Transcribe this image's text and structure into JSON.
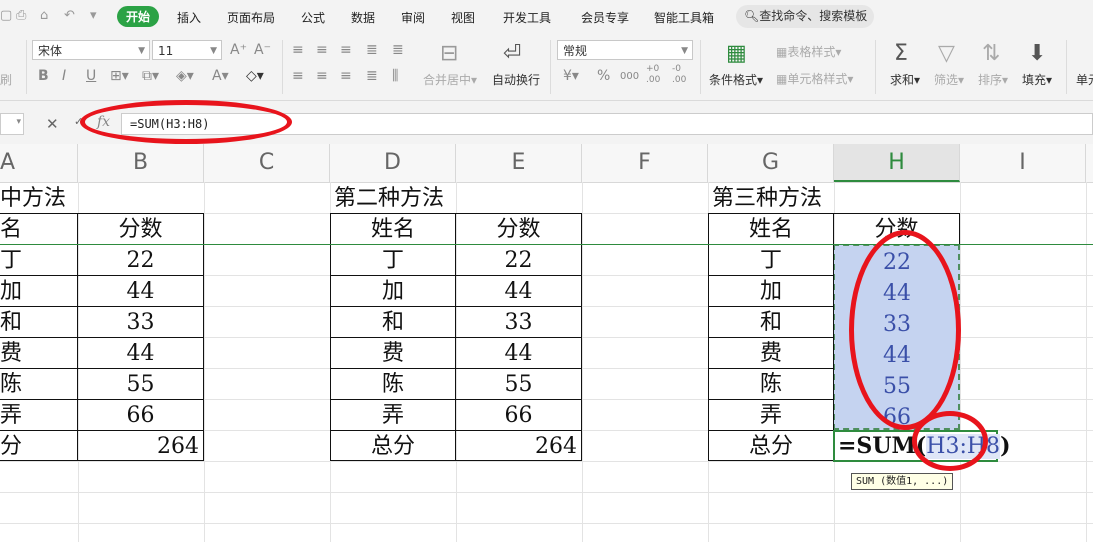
{
  "menu": {
    "tabs": [
      "开始",
      "插入",
      "页面布局",
      "公式",
      "数据",
      "审阅",
      "视图",
      "开发工具",
      "会员专享",
      "智能工具箱"
    ],
    "search_placeholder": "查找命令、搜索模板"
  },
  "toolbar": {
    "font_name": "宋体",
    "font_size": "11",
    "number_format": "常规",
    "labels": {
      "merge_center": "合并居中",
      "wrap_text": "自动换行",
      "conditional_format": "条件格式",
      "table_style": "表格样式",
      "cell_style": "单元格样式",
      "sum": "求和",
      "filter": "筛选",
      "sort": "排序",
      "fill": "填充",
      "cell_partial": "单元",
      "clipboard_partial": "刷"
    },
    "number_symbols": {
      "currency": "¥",
      "percent": "%",
      "thousands": "000",
      "inc_decimal": "+0 .00",
      "dec_decimal": "-0 .00"
    }
  },
  "formula_bar": {
    "fx": "fx",
    "formula": "=SUM(H3:H8)"
  },
  "columns": [
    "A",
    "B",
    "C",
    "D",
    "E",
    "F",
    "G",
    "H",
    "I"
  ],
  "sheet": {
    "section1": {
      "title": "中方法",
      "header_name": "名",
      "header_score": "分数",
      "names": [
        "丁",
        "加",
        "和",
        "费",
        "陈",
        "弄"
      ],
      "scores": [
        "22",
        "44",
        "33",
        "44",
        "55",
        "66"
      ],
      "total_label": "分",
      "total": "264"
    },
    "section2": {
      "title": "第二种方法",
      "header_name": "姓名",
      "header_score": "分数",
      "names": [
        "丁",
        "加",
        "和",
        "费",
        "陈",
        "弄"
      ],
      "scores": [
        "22",
        "44",
        "33",
        "44",
        "55",
        "66"
      ],
      "total_label": "总分",
      "total": "264"
    },
    "section3": {
      "title": "第三种方法",
      "header_name": "姓名",
      "header_score": "分数",
      "names": [
        "丁",
        "加",
        "和",
        "费",
        "陈",
        "弄"
      ],
      "scores": [
        "22",
        "44",
        "33",
        "44",
        "55",
        "66"
      ],
      "total_label": "总分"
    }
  },
  "editor": {
    "prefix": "=SUM(",
    "ref": "H3:H8",
    "suffix": ")"
  },
  "tooltip": "SUM (数值1, ...)",
  "colors": {
    "accent": "#2ba245",
    "selection": "#c5d3f0",
    "annotation": "#e8141c"
  }
}
